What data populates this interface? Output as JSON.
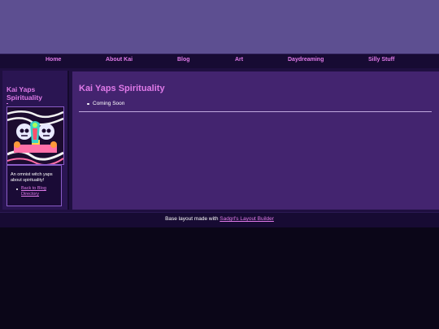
{
  "nav": {
    "items": [
      {
        "label": "Home"
      },
      {
        "label": "About Kai"
      },
      {
        "label": "Blog"
      },
      {
        "label": "Art"
      },
      {
        "label": "Daydreaming"
      },
      {
        "label": "Silly Stuff"
      }
    ]
  },
  "sidebar": {
    "title": "Kai Yaps Spirituality",
    "avatar_icon": "psychedelic-skulls-art",
    "description": "An omnist witch yaps about spirituality!",
    "links": [
      {
        "label": "Back to Blog Directory"
      }
    ]
  },
  "main": {
    "title": "Kai Yaps Spirituality",
    "items": [
      "Coming Soon"
    ]
  },
  "footer": {
    "prefix": "Base layout made with ",
    "link_label": "Sadgrl's Layout Builder"
  },
  "colors": {
    "accent": "#e07ae9",
    "banner": "#5d4f91",
    "nav_bg": "#170b33",
    "content_bg": "#43246f",
    "page_bg": "#0b0618"
  }
}
